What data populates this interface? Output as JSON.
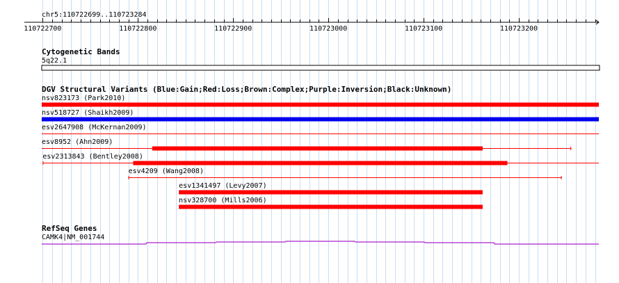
{
  "region": {
    "label": "chr5:110722699..110723284",
    "start": 110722699,
    "end": 110723284
  },
  "ruler": {
    "ticks": [
      "110722700",
      "110722800",
      "110722900",
      "110723000",
      "110723100",
      "110723200"
    ]
  },
  "tracks": {
    "cytoband": {
      "title": "Cytogenetic Bands",
      "band": "5q22.1"
    },
    "dgv": {
      "title": "DGV Structural Variants (Blue:Gain;Red:Loss;Brown:Complex;Purple:Inversion;Black:Unknown)",
      "colors": {
        "gain": "#0000ee",
        "loss": "#ff0000"
      },
      "features": [
        {
          "label": "nsv823173 (Park2010)",
          "type": "loss",
          "thick_start": 110722699,
          "thick_end": 110723284,
          "thin_start": null,
          "thin_end": null
        },
        {
          "label": "nsv518727 (Shaikh2009)",
          "type": "gain",
          "thick_start": 110722699,
          "thick_end": 110723284,
          "thin_start": null,
          "thin_end": null
        },
        {
          "label": "esv2647908 (McKernan2009)",
          "type": "loss",
          "thick_start": null,
          "thick_end": null,
          "thin_start": 110722699,
          "thin_end": 110723284
        },
        {
          "label": "esv8952 (Ahn2009)",
          "type": "loss",
          "thick_start": 110722815,
          "thick_end": 110723162,
          "thin_start": 110722699,
          "thin_end": 110723255
        },
        {
          "label": "esv2313843 (Bentley2008)",
          "type": "loss",
          "thick_start": 110722795,
          "thick_end": 110723188,
          "thin_start": 110722700,
          "thin_end": 110723284
        },
        {
          "label": "esv4209 (Wang2008)",
          "type": "loss",
          "thick_start": null,
          "thick_end": null,
          "thin_start": 110722790,
          "thin_end": 110723245
        },
        {
          "label": "esv1341497 (Levy2007)",
          "type": "loss",
          "thick_start": 110722843,
          "thick_end": 110723162,
          "thin_start": null,
          "thin_end": null
        },
        {
          "label": "nsv328700 (Mills2006)",
          "type": "loss",
          "thick_start": 110722843,
          "thick_end": 110723162,
          "thin_start": null,
          "thin_end": null
        }
      ]
    },
    "refseq": {
      "title": "RefSeq Genes",
      "gene": "CAMK4|NM_001744",
      "color": "#aa22cc"
    }
  }
}
